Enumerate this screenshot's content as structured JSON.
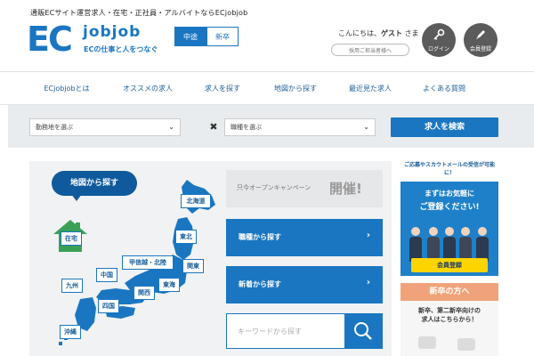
{
  "header": {
    "tagline": "通販ECサイト運営求人・在宅・正社員・アルバイトならECjobjob",
    "logo_main": "EC",
    "logo_sub": "jobjob",
    "logo_caption": "ECの仕事と人をつなぐ",
    "segment_active": "中途",
    "segment_inactive": "新卒",
    "greeting_prefix": "こんにちは、",
    "greeting_name": "ゲスト",
    "greeting_suffix": " さま",
    "admin_login": "採用ご担当者様へ",
    "login_label": "ログイン",
    "register_label": "会員登録"
  },
  "nav": {
    "items": [
      "ECjobjobとは",
      "オススメの求人",
      "求人を探す",
      "地図から探す",
      "最近見た求人",
      "よくある質問"
    ]
  },
  "search": {
    "location_placeholder": "勤務地を選ぶ",
    "times": "✖",
    "occupation_placeholder": "職種を選ぶ",
    "submit_label": "求人を検索"
  },
  "map": {
    "heading": "地図から探す",
    "regions": {
      "hokkaido": "北海道",
      "tohoku": "東北",
      "kanto": "関東",
      "koshinetsu": "甲信越・北陸",
      "tokai": "東海",
      "kansai": "関西",
      "chugoku": "中国",
      "shikoku": "四国",
      "kyushu": "九州",
      "okinawa": "沖縄",
      "zaitaku": "在宅"
    }
  },
  "right": {
    "campaign_text": "只今オープンキャンペーン",
    "campaign_badge": "開催!",
    "occupation_search": "職種から探す",
    "new_arrivals": "新着から探す",
    "keyword_placeholder": "キーワードから探す",
    "arrow": "›"
  },
  "banners": {
    "b1_top": "ご応募やスカウトメールの受信が可能に！",
    "b1_line1": "まずはお気軽に",
    "b1_line2": "ご登録ください!",
    "b1_button": "会員登録",
    "b2_top": "新卒の方へ",
    "b2_line1": "新卒、第二新卒向けの",
    "b2_line2": "求人はこちらから！"
  },
  "colors": {
    "brand_blue": "#1a76c1",
    "dark_blue": "#0f5a9c",
    "map_panel_bg": "#f0f2f3",
    "accent_yellow": "#ffd400",
    "accent_orange": "#f0a37a"
  }
}
